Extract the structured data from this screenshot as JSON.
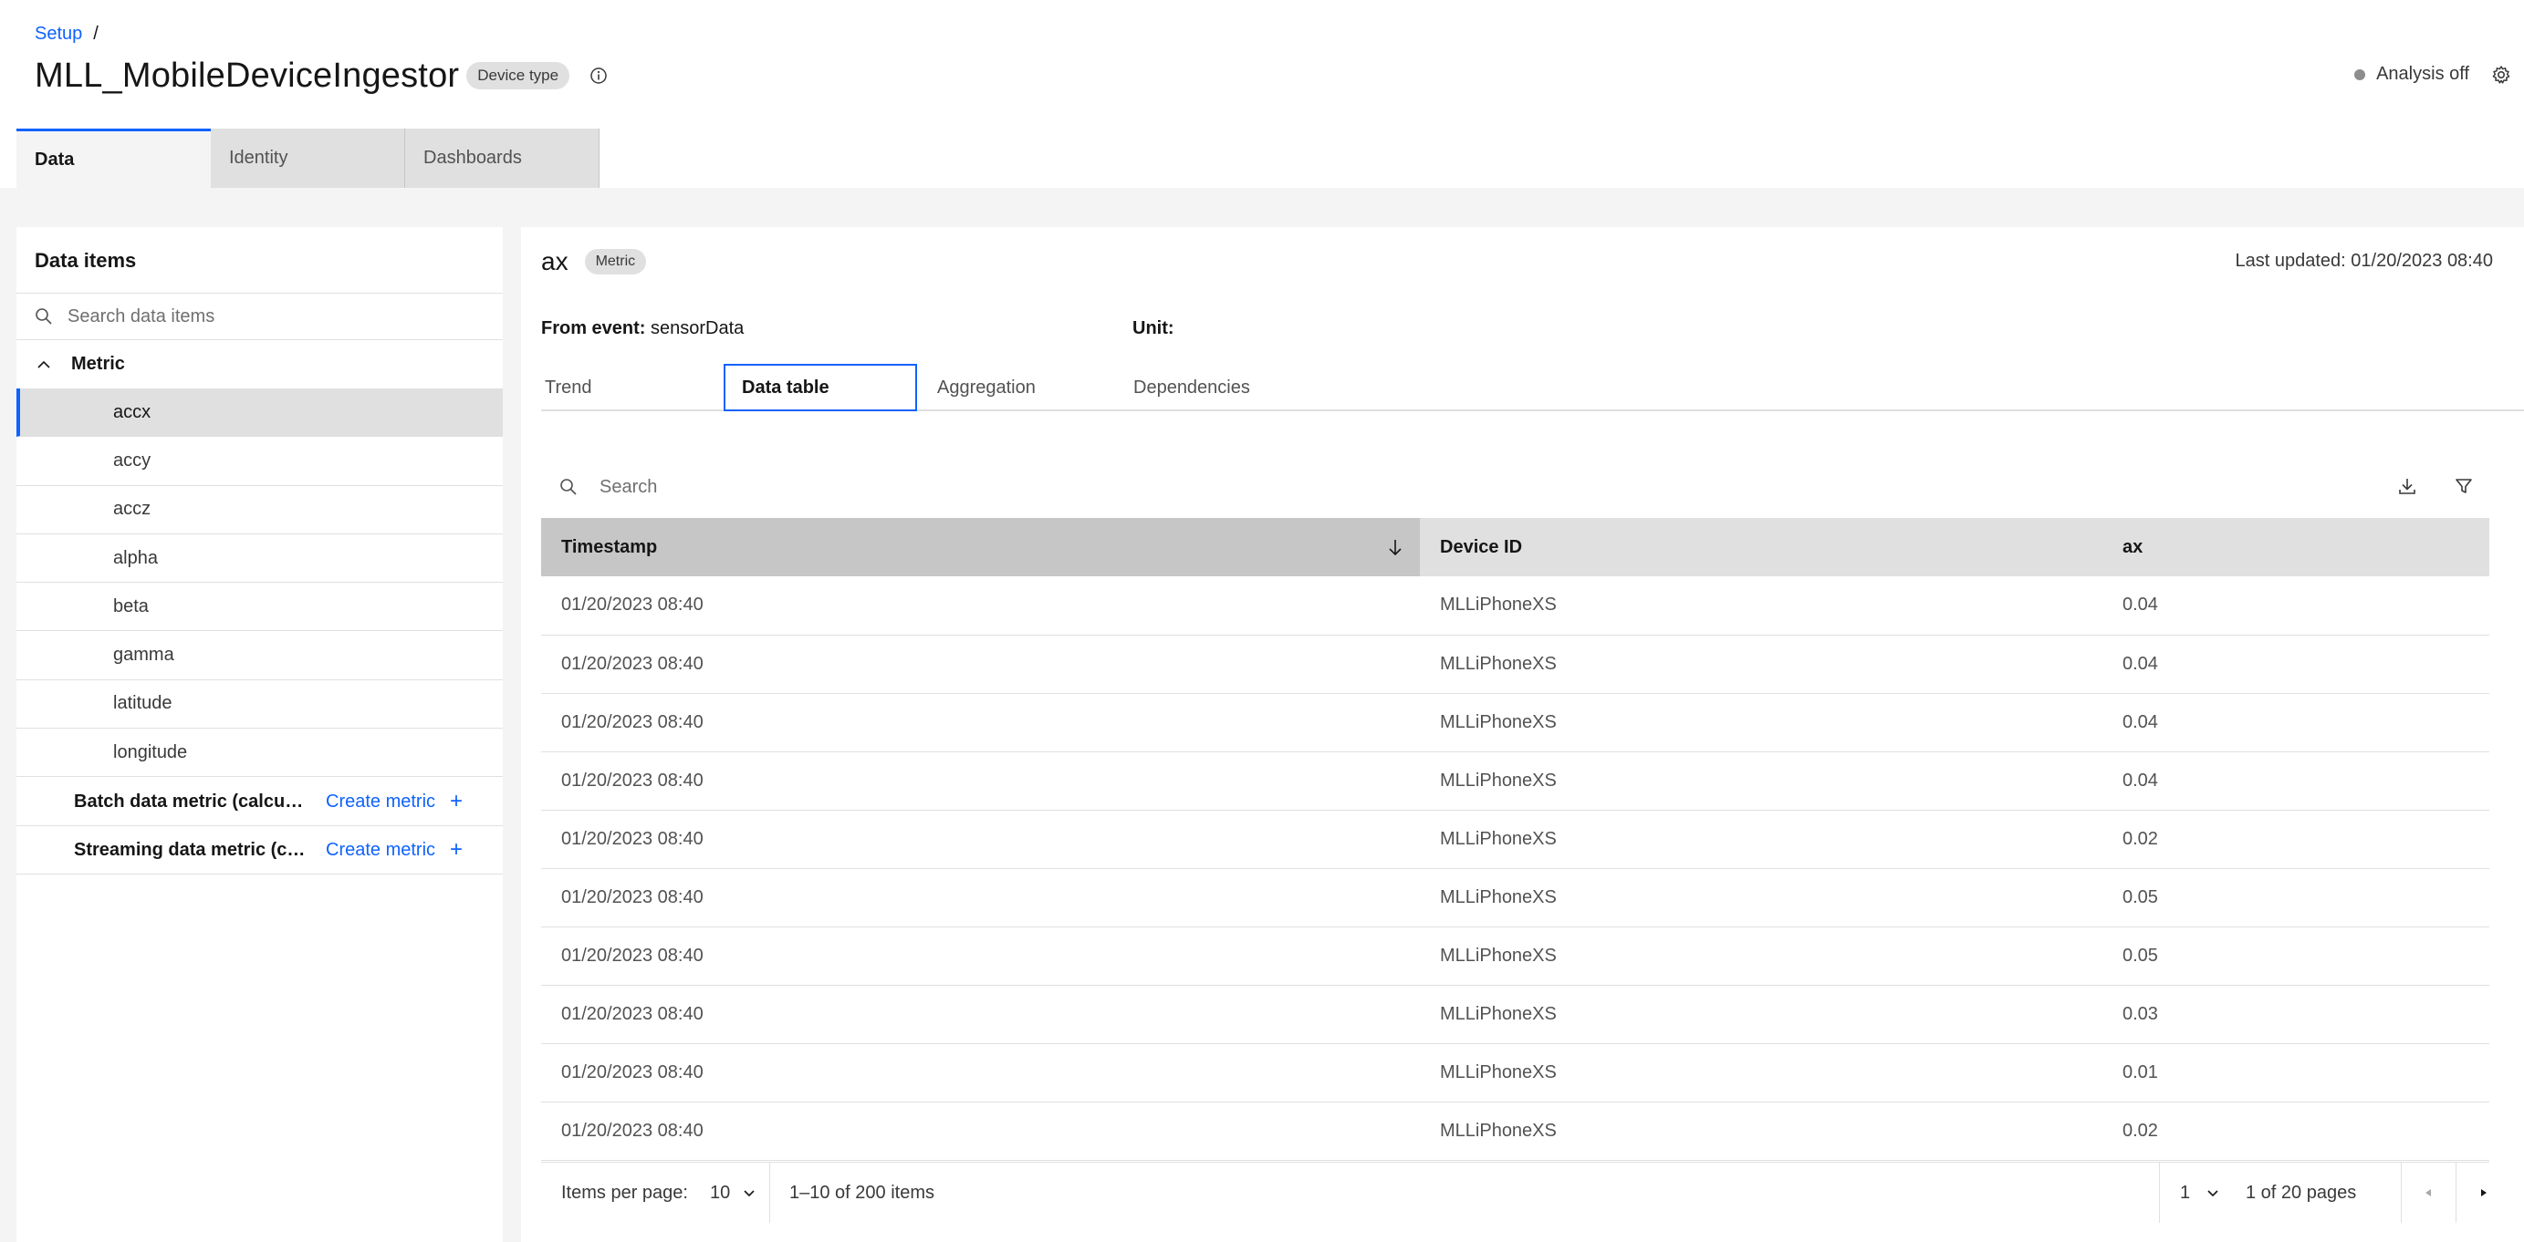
{
  "breadcrumb": {
    "root": "Setup",
    "separator": "/"
  },
  "page": {
    "title": "MLL_MobileDeviceIngestor",
    "type_tag": "Device type"
  },
  "analysis": {
    "status": "Analysis off"
  },
  "top_tabs": [
    {
      "label": "Data",
      "active": true
    },
    {
      "label": "Identity",
      "active": false
    },
    {
      "label": "Dashboards",
      "active": false
    }
  ],
  "left_panel": {
    "title": "Data items",
    "search_placeholder": "Search data items",
    "group_label": "Metric",
    "items": [
      "accx",
      "accy",
      "accz",
      "alpha",
      "beta",
      "gamma",
      "latitude",
      "longitude"
    ],
    "selected_item": "accx",
    "batch": {
      "label": "Batch data metric (calculated)",
      "action": "Create metric"
    },
    "streaming": {
      "label": "Streaming data metric (calculated)",
      "action": "Create metric"
    }
  },
  "detail": {
    "name": "ax",
    "tag": "Metric",
    "last_updated": "Last updated: 01/20/2023 08:40",
    "from_event_label": "From event:",
    "from_event_value": "sensorData",
    "unit_label": "Unit:",
    "unit_value": "",
    "tabs": [
      "Trend",
      "Data table",
      "Aggregation",
      "Dependencies"
    ],
    "active_tab": "Data table"
  },
  "table": {
    "search_placeholder": "Search",
    "columns": [
      "Timestamp",
      "Device ID",
      "ax"
    ],
    "rows": [
      [
        "01/20/2023 08:40",
        "MLLiPhoneXS",
        "0.04"
      ],
      [
        "01/20/2023 08:40",
        "MLLiPhoneXS",
        "0.04"
      ],
      [
        "01/20/2023 08:40",
        "MLLiPhoneXS",
        "0.04"
      ],
      [
        "01/20/2023 08:40",
        "MLLiPhoneXS",
        "0.04"
      ],
      [
        "01/20/2023 08:40",
        "MLLiPhoneXS",
        "0.02"
      ],
      [
        "01/20/2023 08:40",
        "MLLiPhoneXS",
        "0.05"
      ],
      [
        "01/20/2023 08:40",
        "MLLiPhoneXS",
        "0.05"
      ],
      [
        "01/20/2023 08:40",
        "MLLiPhoneXS",
        "0.03"
      ],
      [
        "01/20/2023 08:40",
        "MLLiPhoneXS",
        "0.01"
      ],
      [
        "01/20/2023 08:40",
        "MLLiPhoneXS",
        "0.02"
      ]
    ]
  },
  "pagination": {
    "items_per_page_label": "Items per page:",
    "items_per_page": "10",
    "range": "1–10 of 200 items",
    "page": "1",
    "pages": "1 of 20 pages"
  },
  "colors": {
    "accent": "#0f62fe",
    "status_off": "#8d8d8d"
  }
}
